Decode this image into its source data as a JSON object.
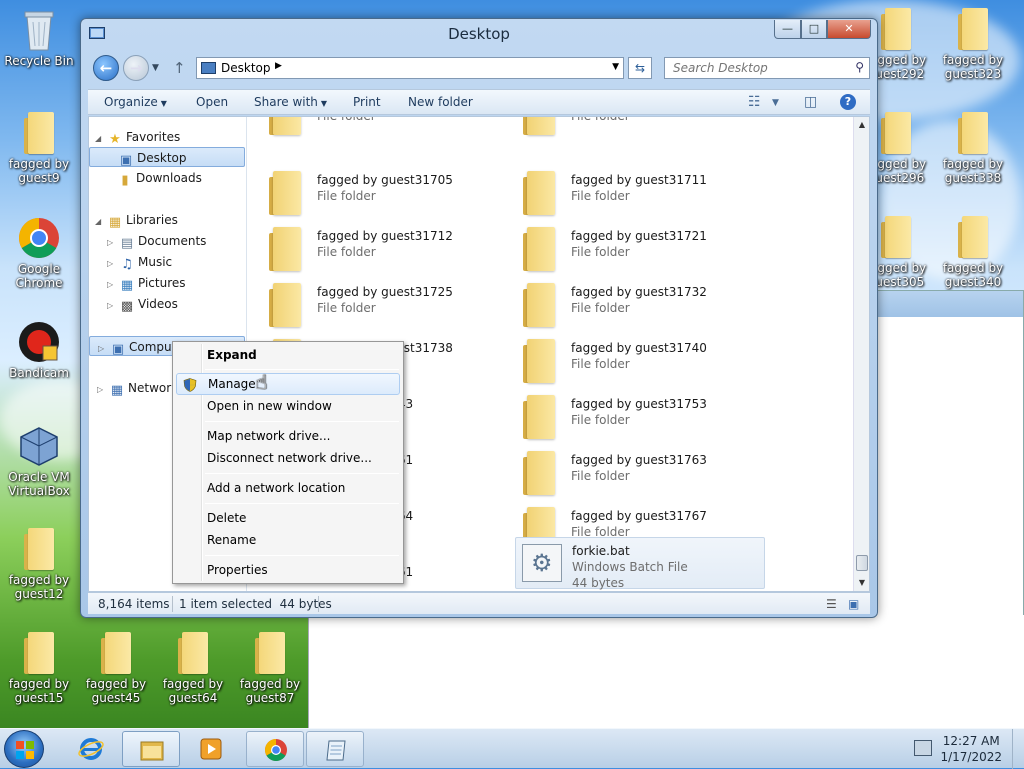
{
  "desktop": {
    "icons": [
      {
        "label": "Recycle Bin"
      },
      {
        "label": "fagged by guest9"
      },
      {
        "label": "Google Chrome"
      },
      {
        "label": "Bandicam"
      },
      {
        "label": "Oracle VM VirtualBox"
      },
      {
        "label": "fagged by guest12"
      },
      {
        "label": "fagged by guest15"
      },
      {
        "label": "fagged by guest45"
      },
      {
        "label": "fagged by guest64"
      },
      {
        "label": "fagged by guest87"
      },
      {
        "label": "fagged by guest292"
      },
      {
        "label": "fagged by guest323"
      },
      {
        "label": "fagged by guest296"
      },
      {
        "label": "fagged by guest338"
      },
      {
        "label": "fagged by guest305"
      },
      {
        "label": "fagged by guest340"
      }
    ]
  },
  "window": {
    "title": "Desktop",
    "address": "Desktop",
    "search_placeholder": "Search Desktop"
  },
  "toolbar": {
    "organize": "Organize",
    "open": "Open",
    "share_with": "Share with",
    "print": "Print",
    "new_folder": "New folder"
  },
  "nav": {
    "favorites": "Favorites",
    "desktop": "Desktop",
    "downloads": "Downloads",
    "libraries": "Libraries",
    "documents": "Documents",
    "music": "Music",
    "pictures": "Pictures",
    "videos": "Videos",
    "computer": "Computer",
    "network": "Network"
  },
  "files": [
    {
      "name": "",
      "type": "File folder"
    },
    {
      "name": "",
      "type": "File folder"
    },
    {
      "name": "fagged by guest31705",
      "type": "File folder"
    },
    {
      "name": "fagged by guest31711",
      "type": "File folder"
    },
    {
      "name": "fagged by guest31712",
      "type": "File folder"
    },
    {
      "name": "fagged by guest31721",
      "type": "File folder"
    },
    {
      "name": "fagged by guest31725",
      "type": "File folder"
    },
    {
      "name": "fagged by guest31732",
      "type": "File folder"
    },
    {
      "name": "fagged by guest31738",
      "type": "File folder"
    },
    {
      "name": "fagged by guest31740",
      "type": "File folder"
    },
    {
      "name": "31743",
      "type": ""
    },
    {
      "name": "fagged by guest31753",
      "type": "File folder"
    },
    {
      "name": "31761",
      "type": ""
    },
    {
      "name": "fagged by guest31763",
      "type": "File folder"
    },
    {
      "name": "31764",
      "type": ""
    },
    {
      "name": "fagged by guest31767",
      "type": "File folder"
    },
    {
      "name": "32761",
      "type": ""
    }
  ],
  "selected_file": {
    "name": "forkie.bat",
    "type": "Windows Batch File",
    "size": "44 bytes"
  },
  "status": {
    "count": "8,164 items",
    "selection": "1 item selected  44 bytes"
  },
  "context_menu": {
    "expand": "Expand",
    "manage": "Manage",
    "open_new_window": "Open in new window",
    "map_drive": "Map network drive...",
    "disconnect_drive": "Disconnect network drive...",
    "add_location": "Add a network location",
    "delete": "Delete",
    "rename": "Rename",
    "properties": "Properties"
  },
  "clock": {
    "time": "12:27 AM",
    "date": "1/17/2022"
  }
}
